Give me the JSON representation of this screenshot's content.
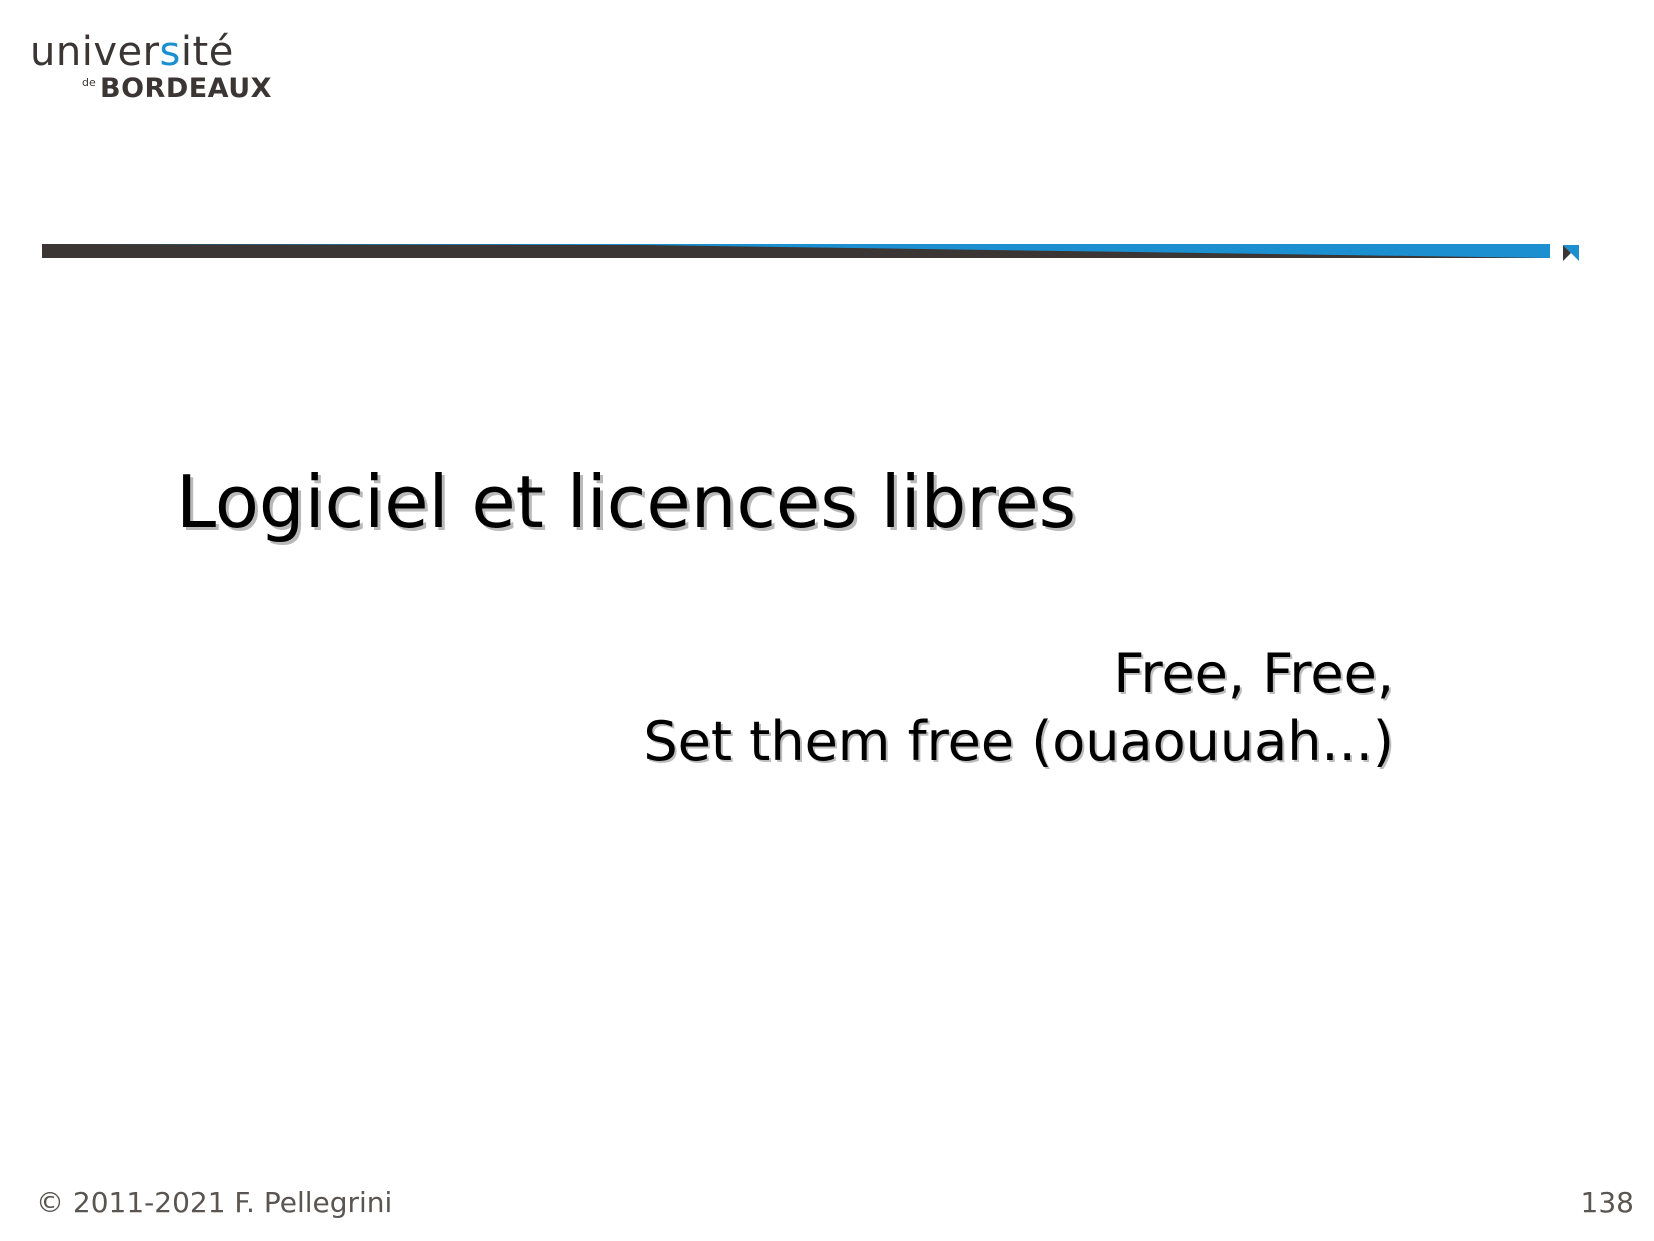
{
  "logo": {
    "word_start": "univer",
    "word_accent": "s",
    "word_end": "ité",
    "de": "de",
    "city": "BORDEAUX"
  },
  "colors": {
    "brand_dark": "#3b3633",
    "brand_blue": "#1b8fd0"
  },
  "slide": {
    "title": "Logiciel et licences libres",
    "subtitle_line1": "Free, Free,",
    "subtitle_line2": "Set them free (ouaouuah...)"
  },
  "footer": {
    "copyright": "© 2011-2021 F. Pellegrini",
    "page_number": "138"
  }
}
